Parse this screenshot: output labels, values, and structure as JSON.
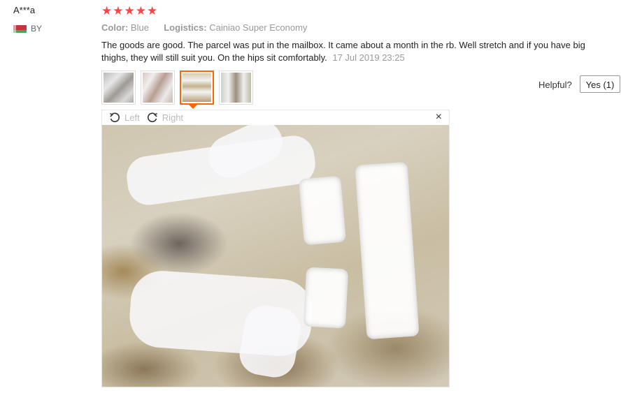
{
  "reviewer": {
    "name": "A***a",
    "country": "BY"
  },
  "rating": {
    "stars": 5,
    "star_color": "#ff4444"
  },
  "attributes": {
    "color_label": "Color:",
    "color_value": "Blue",
    "logistics_label": "Logistics:",
    "logistics_value": "Cainiao Super Economy"
  },
  "review": {
    "text": "The goods are good. The parcel was put in the mailbox. It came about a month in the rb. Well stretch and if you have big thighs, they will still suit you. On the hips sit comfortably.",
    "date": "17 Jul 2019 23:25"
  },
  "thumbnails": {
    "count": 4,
    "active_index": 2,
    "active_color": "#ff6600"
  },
  "helpful": {
    "label": "Helpful?",
    "button": "Yes (1)"
  },
  "viewer": {
    "rotate_left": "Left",
    "rotate_right": "Right",
    "close": "×"
  }
}
